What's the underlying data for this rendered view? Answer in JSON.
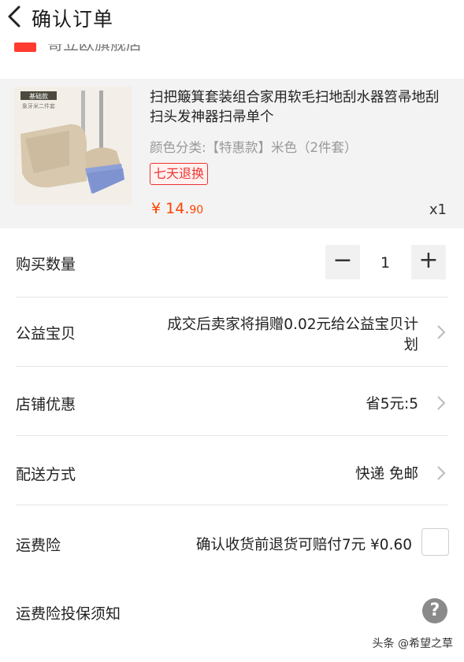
{
  "header": {
    "back_icon": "back-arrow-icon",
    "title": "确认订单"
  },
  "shop": {
    "name": "哥立欧旗舰店",
    "badge_color": "#ff3b30"
  },
  "product": {
    "image_icon": "broom-dustpan-image",
    "image_label": "基础款",
    "image_sub": "象牙米二件套",
    "title": "扫把簸箕套装组合家用软毛扫地刮水器笤帚地刮扫头发神器扫帚单个",
    "spec": "颜色分类:【特惠款】米色（2件套）",
    "tag": "七天退换",
    "price_symbol": "¥ ",
    "price_int": "14.",
    "price_dec": "90",
    "qty": "x1",
    "price_color": "#ff4400"
  },
  "quantity": {
    "label": "购买数量",
    "minus": "−",
    "value": "1",
    "plus": "+"
  },
  "charity": {
    "label": "公益宝贝",
    "value_line1": "成交后卖家将捐赠0.02元给公益宝贝计",
    "value_line2": "划"
  },
  "discount": {
    "label": "店铺优惠",
    "value": "省5元:5"
  },
  "delivery": {
    "label": "配送方式",
    "value": "快递 免邮"
  },
  "insurance": {
    "label": "运费险",
    "value": "确认收货前退货可赔付7元 ¥0.60"
  },
  "notice": {
    "label": "运费险投保须知",
    "help_icon": "question-icon",
    "help_glyph": "?"
  },
  "watermark": "头条 @希望之草"
}
